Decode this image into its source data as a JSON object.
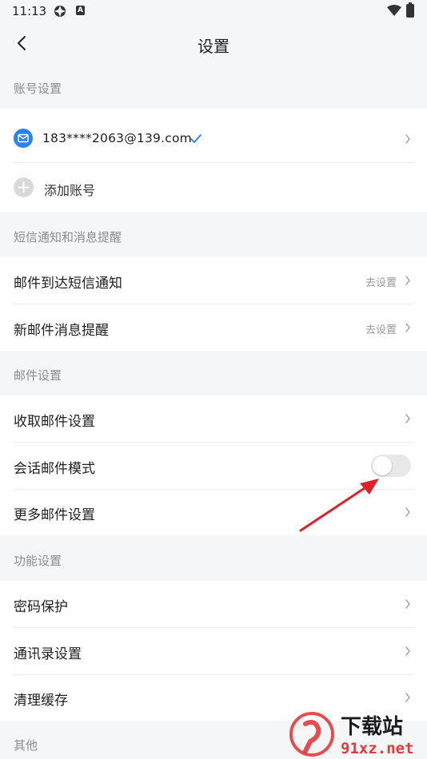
{
  "status_bar": {
    "time": "11:13",
    "badge": "A"
  },
  "nav": {
    "title": "设置"
  },
  "sections": {
    "account": {
      "header": "账号设置",
      "email": "183****2063@139.com",
      "add_account": "添加账号"
    },
    "sms": {
      "header": "短信通知和消息提醒",
      "items": [
        {
          "label": "邮件到达短信通知",
          "hint": "去设置"
        },
        {
          "label": "新邮件消息提醒",
          "hint": "去设置"
        }
      ]
    },
    "mail": {
      "header": "邮件设置",
      "items": [
        {
          "label": "收取邮件设置"
        },
        {
          "label": "会话邮件模式",
          "toggle": false
        },
        {
          "label": "更多邮件设置"
        }
      ]
    },
    "function": {
      "header": "功能设置",
      "items": [
        {
          "label": "密码保护"
        },
        {
          "label": "通讯录设置"
        },
        {
          "label": "清理缓存"
        }
      ]
    },
    "other": {
      "header": "其他"
    }
  },
  "watermark": {
    "brand": "下载站",
    "url": "91xz.net"
  },
  "colors": {
    "accent": "#2a83e8",
    "annotation_arrow": "#d9232a"
  }
}
